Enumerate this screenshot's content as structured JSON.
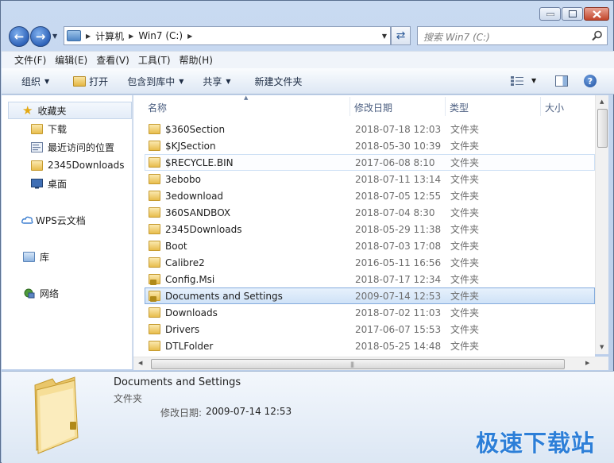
{
  "window": {
    "caption_buttons": [
      "minimize",
      "maximize",
      "close"
    ]
  },
  "address": {
    "crumbs": [
      "计算机",
      "Win7 (C:)"
    ]
  },
  "search": {
    "placeholder": "搜索 Win7 (C:)"
  },
  "menu": [
    "文件(F)",
    "编辑(E)",
    "查看(V)",
    "工具(T)",
    "帮助(H)"
  ],
  "toolbar": {
    "organize": "组织",
    "open": "打开",
    "include_library": "包含到库中",
    "share": "共享",
    "new_folder": "新建文件夹"
  },
  "nav": {
    "favorites": "收藏夹",
    "downloads": "下载",
    "recent": "最近访问的位置",
    "downloads2345": "2345Downloads",
    "desktop": "桌面",
    "wps": "WPS云文档",
    "libraries": "库",
    "network": "网络"
  },
  "columns": {
    "name": "名称",
    "modified": "修改日期",
    "type": "类型",
    "size": "大小"
  },
  "files": [
    {
      "name": "$360Section",
      "date": "2018-07-18 12:03",
      "type": "文件夹",
      "locked": false,
      "state": ""
    },
    {
      "name": "$KJSection",
      "date": "2018-05-30 10:39",
      "type": "文件夹",
      "locked": false,
      "state": ""
    },
    {
      "name": "$RECYCLE.BIN",
      "date": "2017-06-08 8:10",
      "type": "文件夹",
      "locked": false,
      "state": "hover"
    },
    {
      "name": "3ebobo",
      "date": "2018-07-11 13:14",
      "type": "文件夹",
      "locked": false,
      "state": ""
    },
    {
      "name": "3edownload",
      "date": "2018-07-05 12:55",
      "type": "文件夹",
      "locked": false,
      "state": ""
    },
    {
      "name": "360SANDBOX",
      "date": "2018-07-04 8:30",
      "type": "文件夹",
      "locked": false,
      "state": ""
    },
    {
      "name": "2345Downloads",
      "date": "2018-05-29 11:38",
      "type": "文件夹",
      "locked": false,
      "state": ""
    },
    {
      "name": "Boot",
      "date": "2018-07-03 17:08",
      "type": "文件夹",
      "locked": false,
      "state": ""
    },
    {
      "name": "Calibre2",
      "date": "2016-05-11 16:56",
      "type": "文件夹",
      "locked": false,
      "state": ""
    },
    {
      "name": "Config.Msi",
      "date": "2018-07-17 12:34",
      "type": "文件夹",
      "locked": true,
      "state": ""
    },
    {
      "name": "Documents and Settings",
      "date": "2009-07-14 12:53",
      "type": "文件夹",
      "locked": true,
      "state": "selected"
    },
    {
      "name": "Downloads",
      "date": "2018-07-02 11:03",
      "type": "文件夹",
      "locked": false,
      "state": ""
    },
    {
      "name": "Drivers",
      "date": "2017-06-07 15:53",
      "type": "文件夹",
      "locked": false,
      "state": ""
    },
    {
      "name": "DTLFolder",
      "date": "2018-05-25 14:48",
      "type": "文件夹",
      "locked": false,
      "state": ""
    }
  ],
  "details": {
    "name": "Documents and Settings",
    "type": "文件夹",
    "modified_label": "修改日期:",
    "modified_value": "2009-07-14 12:53"
  },
  "watermark": "极速下载站",
  "colors": {
    "accent": "#2d7fd8",
    "selection": "#cfe2f7",
    "folder": "#e8bd4d"
  }
}
